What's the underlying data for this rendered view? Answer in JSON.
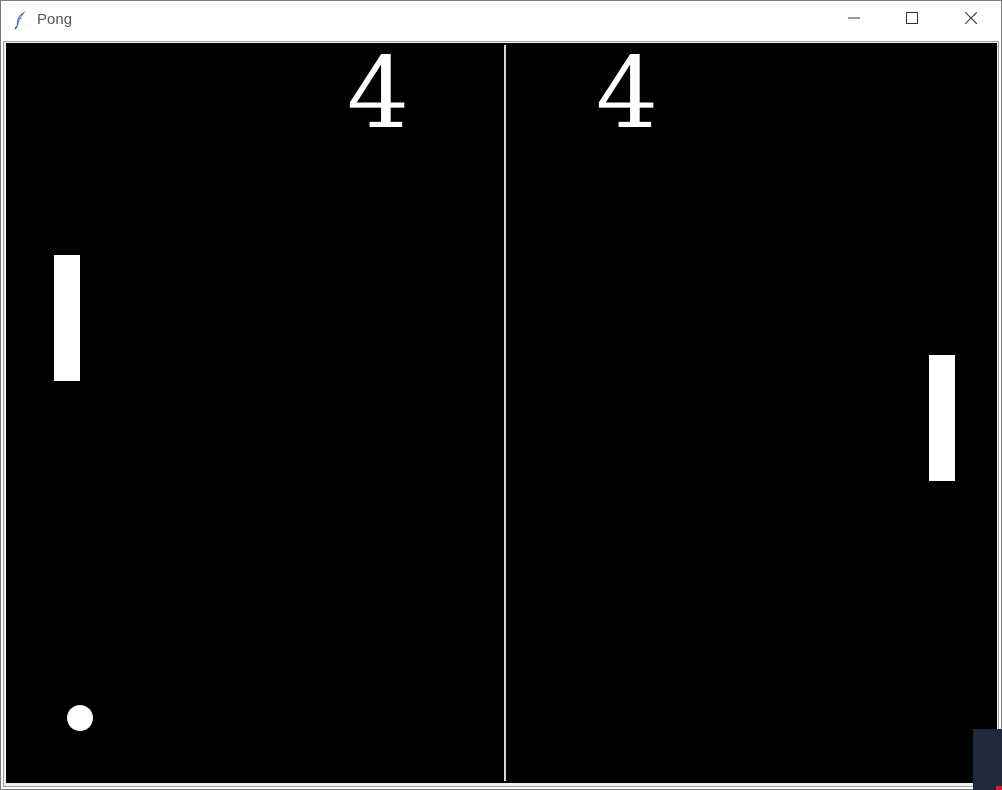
{
  "window": {
    "title": "Pong",
    "app_icon": "feather-icon",
    "controls": [
      "minimize-icon",
      "maximize-icon",
      "close-icon"
    ]
  },
  "game": {
    "left_score": "4",
    "right_score": "4",
    "colors": {
      "court": "#000000",
      "paddle": "#ffffff",
      "ball": "#ffffff",
      "net": "#d8d8d8"
    }
  }
}
